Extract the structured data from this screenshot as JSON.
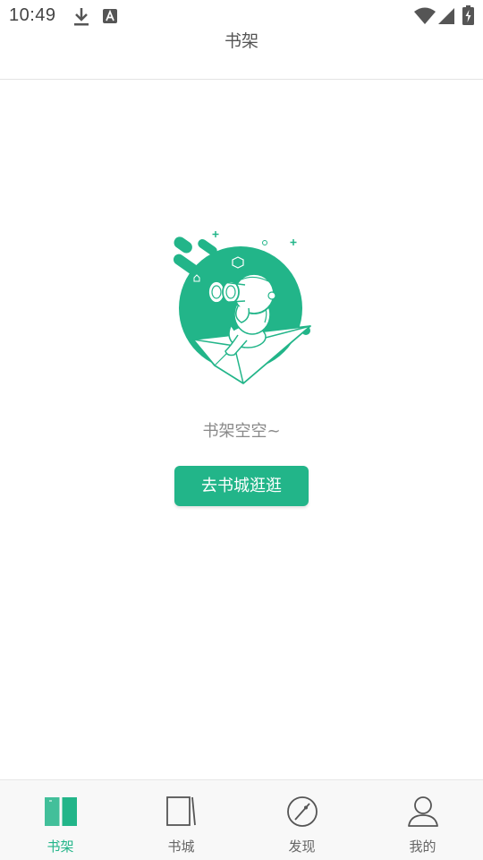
{
  "status_bar": {
    "time": "10:49",
    "icons": [
      "download-icon",
      "text-a-icon",
      "wifi-icon",
      "signal-icon",
      "battery-charging-icon"
    ]
  },
  "header": {
    "title": "书架"
  },
  "empty_state": {
    "illustration": "astronaut-on-paper-plane-with-binoculars",
    "message": "书架空空~",
    "button_label": "去书城逛逛"
  },
  "bottom_nav": {
    "active_index": 0,
    "items": [
      {
        "label": "书架",
        "icon": "bookshelf-icon"
      },
      {
        "label": "书城",
        "icon": "bookstore-icon"
      },
      {
        "label": "发现",
        "icon": "compass-icon"
      },
      {
        "label": "我的",
        "icon": "profile-icon"
      }
    ]
  },
  "colors": {
    "accent": "#22b589",
    "text_secondary": "#8a8a8a",
    "nav_inactive": "#666666"
  }
}
